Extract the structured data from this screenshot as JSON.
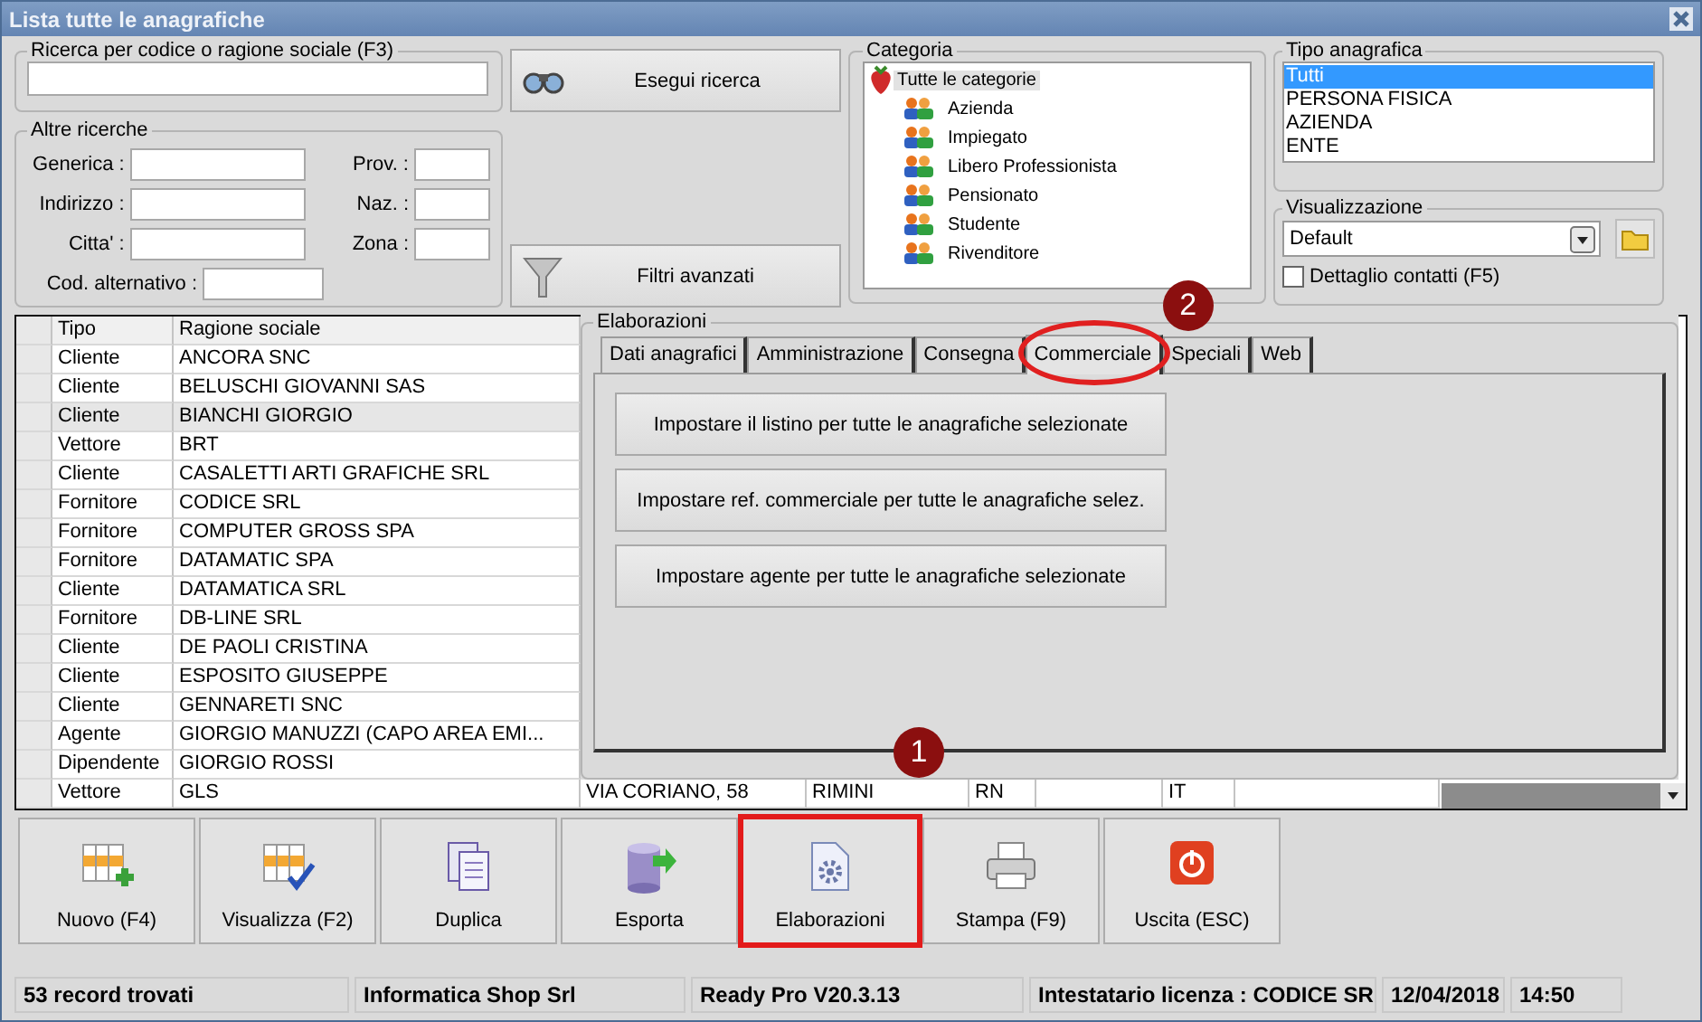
{
  "window": {
    "title": "Lista tutte le anagrafiche"
  },
  "search": {
    "label": "Ricerca per codice o ragione sociale (F3)"
  },
  "other_searches": {
    "label": "Altre ricerche",
    "rows": [
      [
        {
          "label": "Generica :"
        },
        {
          "label": "Prov. :"
        }
      ],
      [
        {
          "label": "Indirizzo :"
        },
        {
          "label": "Naz. :"
        }
      ],
      [
        {
          "label": "Citta' :"
        },
        {
          "label": "Zona :"
        }
      ],
      [
        {
          "label": "Cod. alternativo :"
        }
      ]
    ]
  },
  "actions": [
    {
      "kind": "search",
      "label": "Esegui ricerca"
    },
    {
      "kind": "filter",
      "label": "Filtri avanzati"
    }
  ],
  "category": {
    "label": "Categoria",
    "root": {
      "label": "Tutte le categorie",
      "selected": true,
      "children": [
        {
          "label": "Azienda",
          "selected": false
        },
        {
          "label": "Impiegato",
          "selected": false
        },
        {
          "label": "Libero Professionista",
          "selected": false
        },
        {
          "label": "Pensionato",
          "selected": false
        },
        {
          "label": "Studente",
          "selected": false
        },
        {
          "label": "Rivenditore",
          "selected": false
        }
      ]
    }
  },
  "record_type": {
    "label": "Tipo anagrafica",
    "items": [
      {
        "label": "Tutti",
        "selected": true
      },
      {
        "label": "PERSONA FISICA",
        "selected": false
      },
      {
        "label": "AZIENDA",
        "selected": false
      },
      {
        "label": "ENTE",
        "selected": false
      }
    ]
  },
  "view": {
    "label": "Visualizzazione",
    "value": "Default",
    "contacts_detail": {
      "label": "Dettaglio contatti (F5)",
      "checked": false
    }
  },
  "table": {
    "columns": [
      "Tipo",
      "Ragione sociale"
    ],
    "rows": [
      {
        "selected": false,
        "cells": {
          "tipo": "Cliente",
          "ragione_sociale": "ANCORA SNC"
        }
      },
      {
        "selected": false,
        "cells": {
          "tipo": "Cliente",
          "ragione_sociale": "BELUSCHI GIOVANNI SAS"
        }
      },
      {
        "selected": true,
        "cells": {
          "tipo": "Cliente",
          "ragione_sociale": "BIANCHI GIORGIO"
        }
      },
      {
        "selected": false,
        "cells": {
          "tipo": "Vettore",
          "ragione_sociale": "BRT"
        }
      },
      {
        "selected": false,
        "cells": {
          "tipo": "Cliente",
          "ragione_sociale": "CASALETTI ARTI GRAFICHE SRL"
        }
      },
      {
        "selected": false,
        "cells": {
          "tipo": "Fornitore",
          "ragione_sociale": "CODICE SRL"
        }
      },
      {
        "selected": false,
        "cells": {
          "tipo": "Fornitore",
          "ragione_sociale": "COMPUTER GROSS SPA"
        }
      },
      {
        "selected": false,
        "cells": {
          "tipo": "Fornitore",
          "ragione_sociale": "DATAMATIC SPA"
        }
      },
      {
        "selected": false,
        "cells": {
          "tipo": "Cliente",
          "ragione_sociale": "DATAMATICA SRL"
        }
      },
      {
        "selected": false,
        "cells": {
          "tipo": "Fornitore",
          "ragione_sociale": "DB-LINE SRL"
        }
      },
      {
        "selected": false,
        "cells": {
          "tipo": "Cliente",
          "ragione_sociale": "DE PAOLI CRISTINA"
        }
      },
      {
        "selected": false,
        "cells": {
          "tipo": "Cliente",
          "ragione_sociale": "ESPOSITO GIUSEPPE"
        }
      },
      {
        "selected": false,
        "cells": {
          "tipo": "Cliente",
          "ragione_sociale": "GENNARETI SNC"
        }
      },
      {
        "selected": false,
        "cells": {
          "tipo": "Agente",
          "ragione_sociale": "GIORGIO MANUZZI (CAPO AREA EMI..."
        }
      },
      {
        "selected": false,
        "cells": {
          "tipo": "Dipendente",
          "ragione_sociale": "GIORGIO ROSSI"
        }
      },
      {
        "selected": false,
        "cells": {
          "tipo": "Vettore",
          "ragione_sociale": "GLS",
          "column_3": "VIA CORIANO, 58",
          "column_4": "RIMINI",
          "column_5": "RN",
          "column_7": "IT"
        }
      }
    ]
  },
  "processing": {
    "label": "Elaborazioni",
    "tabs": [
      {
        "label": "Dati anagrafici",
        "selected": false
      },
      {
        "label": "Amministrazione",
        "selected": false
      },
      {
        "label": "Consegna",
        "selected": false
      },
      {
        "label": "Commerciale",
        "selected": true,
        "circled": true,
        "badge": "2"
      },
      {
        "label": "Speciali",
        "selected": false
      },
      {
        "label": "Web",
        "selected": false
      }
    ],
    "buttons": [
      "Impostare il listino per tutte le anagrafiche selezionate",
      "Impostare ref. commerciale per tutte le anagrafiche selez.",
      "Impostare agente per tutte le anagrafiche selezionate"
    ]
  },
  "toolbar": [
    {
      "kind": "new",
      "label": "Nuovo (F4)",
      "highlighted": false
    },
    {
      "kind": "view",
      "label": "Visualizza (F2)",
      "highlighted": false
    },
    {
      "kind": "duplicate",
      "label": "Duplica",
      "highlighted": false
    },
    {
      "kind": "export",
      "label": "Esporta",
      "highlighted": false
    },
    {
      "kind": "process",
      "label": "Elaborazioni",
      "highlighted": true,
      "badge": "1"
    },
    {
      "kind": "print",
      "label": "Stampa (F9)",
      "highlighted": false
    },
    {
      "kind": "exit",
      "label": "Uscita (ESC)",
      "highlighted": false
    }
  ],
  "status_bar": [
    "53 record trovati",
    "Informatica Shop Srl",
    "Ready Pro V20.3.13",
    "Intestatario licenza : CODICE SR",
    "12/04/2018",
    "14:50"
  ]
}
